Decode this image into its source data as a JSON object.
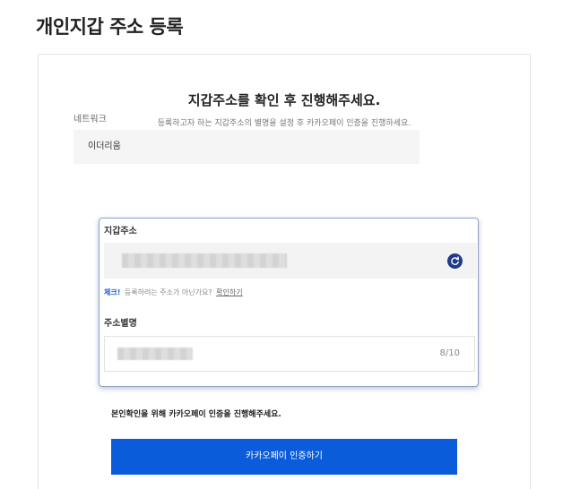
{
  "page": {
    "title": "개인지갑 주소 등록"
  },
  "card": {
    "heading": "지갑주소를 확인 후 진행해주세요.",
    "subtitle": "등록하고자 하는 지갑주소의 별명을 설정 후 카카오페이 인증을 진행하세요."
  },
  "network": {
    "label": "네트워크",
    "value": "이더리움"
  },
  "address": {
    "label": "지갑주소",
    "check_strong": "체크!",
    "check_text": "등록하려는 주소가 아닌가요?",
    "check_link": "확인하기"
  },
  "nickname": {
    "label": "주소별명",
    "count": "8/10"
  },
  "verify": {
    "notice": "본인확인을 위해 카카오페이 인증을 진행해주세요.",
    "button_label": "카카오페이 인증하기"
  },
  "colors": {
    "primary": "#0a5cdb",
    "refresh_icon": "#1f3c88",
    "check_accent": "#1a5fd0"
  },
  "icons": {
    "refresh": "refresh-icon"
  }
}
